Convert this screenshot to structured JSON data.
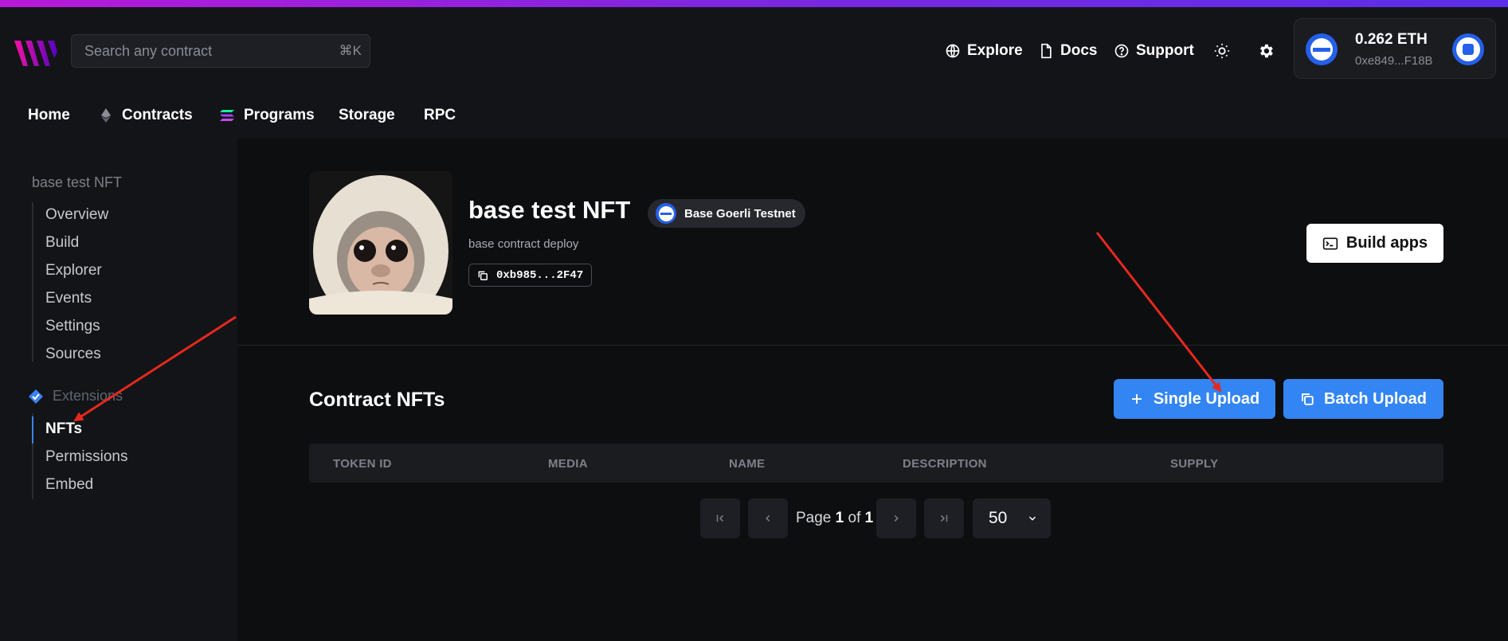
{
  "header": {
    "search_placeholder": "Search any contract",
    "search_shortcut": "⌘K",
    "links": [
      {
        "label": "Explore",
        "icon": "globe-icon"
      },
      {
        "label": "Docs",
        "icon": "document-icon"
      },
      {
        "label": "Support",
        "icon": "help-circle-icon"
      }
    ],
    "wallet": {
      "balance": "0.262 ETH",
      "address": "0xe849...F18B"
    }
  },
  "mainnav": {
    "items": [
      "Home",
      "Contracts",
      "Programs",
      "Storage",
      "RPC"
    ]
  },
  "sidebar": {
    "contract_name": "base test NFT",
    "items": [
      "Overview",
      "Build",
      "Explorer",
      "Events",
      "Settings",
      "Sources"
    ],
    "extensions_label": "Extensions",
    "extension_items": [
      "NFTs",
      "Permissions",
      "Embed"
    ],
    "active": "NFTs"
  },
  "contract": {
    "title": "base test NFT",
    "network": "Base Goerli Testnet",
    "description": "base contract deploy",
    "address": "0xb985...2F47",
    "build_apps_label": "Build apps"
  },
  "nfts": {
    "section_title": "Contract NFTs",
    "single_upload_label": "Single Upload",
    "batch_upload_label": "Batch Upload",
    "columns": [
      "TOKEN ID",
      "MEDIA",
      "NAME",
      "DESCRIPTION",
      "SUPPLY"
    ],
    "pagination": {
      "prefix": "Page",
      "current": "1",
      "of": "of",
      "total": "1",
      "page_size": "50"
    }
  },
  "colors": {
    "accent": "#3385f3",
    "annotation_arrow": "#e8281e"
  }
}
